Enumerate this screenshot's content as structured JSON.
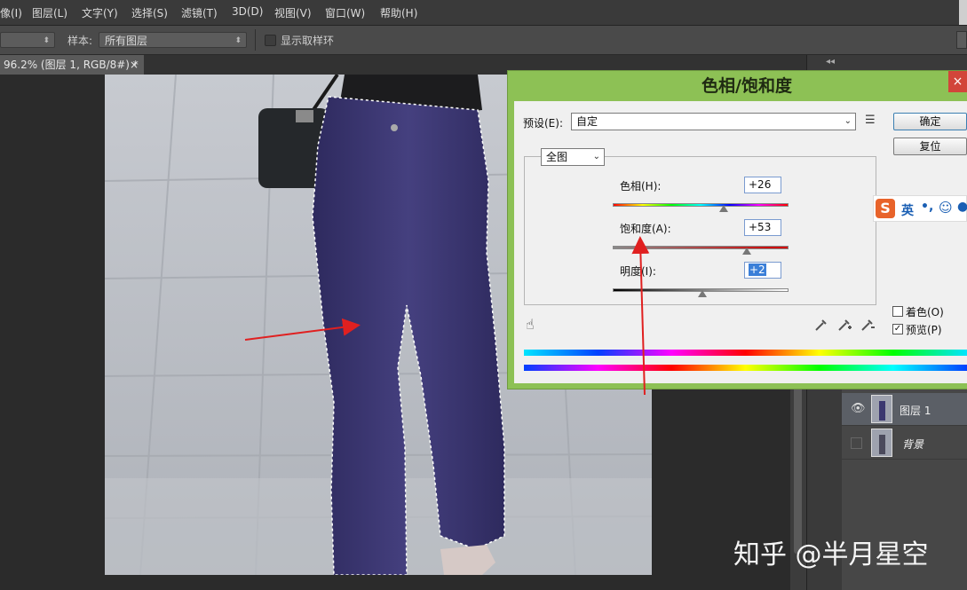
{
  "menu": {
    "items": [
      "像(I)",
      "图层(L)",
      "文字(Y)",
      "选择(S)",
      "滤镜(T)",
      "3D(D)",
      "视图(V)",
      "窗口(W)",
      "帮助(H)"
    ]
  },
  "options": {
    "sample_label": "样本:",
    "sample_value": "所有图层",
    "show_ring_label": "显示取样环"
  },
  "doc_tab": {
    "title": "96.2% (图层 1, RGB/8#) *",
    "close": "×"
  },
  "dialog": {
    "title": "色相/饱和度",
    "preset_label": "预设(E):",
    "preset_value": "自定",
    "ok_label": "确定",
    "reset_label": "复位",
    "channel_value": "全图",
    "hue_label": "色相(H):",
    "hue_value": "+26",
    "saturation_label": "饱和度(A):",
    "saturation_value": "+53",
    "lightness_label": "明度(I):",
    "lightness_value": "+2",
    "colorize_label": "着色(O)",
    "preview_label": "预览(P)",
    "preview_check": "✓"
  },
  "ime": {
    "label": "英",
    "logo": "S"
  },
  "layers": [
    {
      "name": "图层 1",
      "visible": true
    },
    {
      "name": "背景",
      "visible": false
    }
  ],
  "watermark": "知乎 @半月星空",
  "colors": {
    "dialog_accent": "#8dc155",
    "annotation_arrow": "#e02020",
    "jeans": "#3a3570"
  }
}
